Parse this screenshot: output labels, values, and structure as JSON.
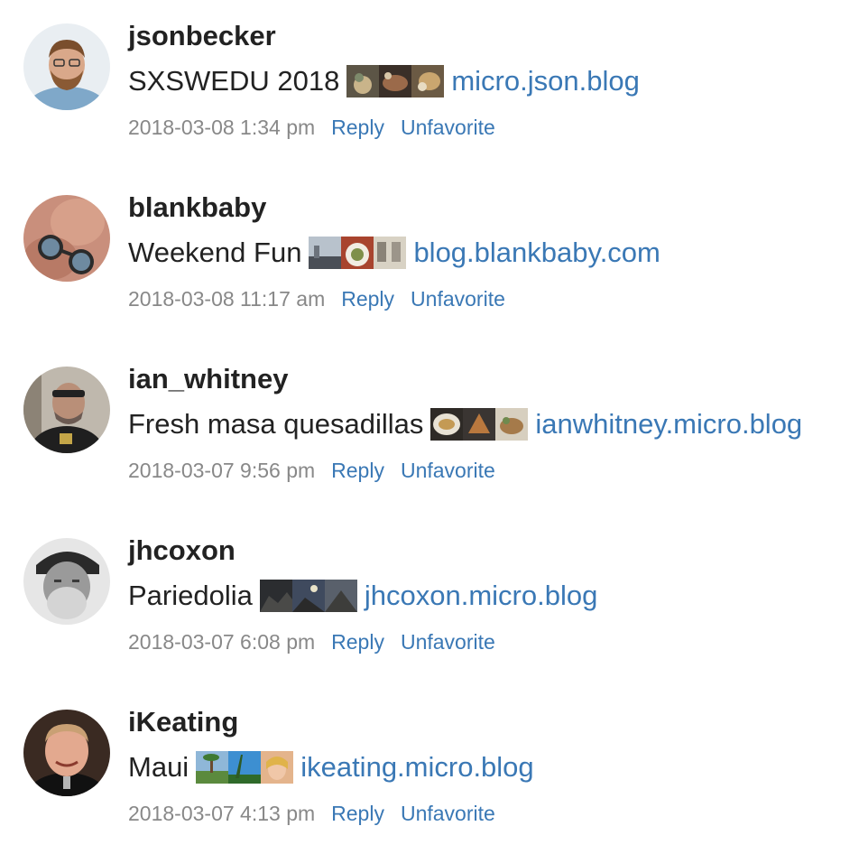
{
  "colors": {
    "text": "#222222",
    "link": "#3a78b5",
    "muted": "#888888",
    "background": "#ffffff"
  },
  "posts": [
    {
      "username": "jsonbecker",
      "text": "SXSWEDU 2018",
      "blog": "micro.json.blog",
      "timestamp": "2018-03-08 1:34 pm",
      "reply_label": "Reply",
      "unfavorite_label": "Unfavorite",
      "photo_count": 3
    },
    {
      "username": "blankbaby",
      "text": "Weekend Fun",
      "blog": "blog.blankbaby.com",
      "timestamp": "2018-03-08 11:17 am",
      "reply_label": "Reply",
      "unfavorite_label": "Unfavorite",
      "photo_count": 3
    },
    {
      "username": "ian_whitney",
      "text": "Fresh masa quesadillas",
      "blog": "ianwhitney.micro.blog",
      "timestamp": "2018-03-07 9:56 pm",
      "reply_label": "Reply",
      "unfavorite_label": "Unfavorite",
      "photo_count": 3
    },
    {
      "username": "jhcoxon",
      "text": "Pariedolia",
      "blog": "jhcoxon.micro.blog",
      "timestamp": "2018-03-07 6:08 pm",
      "reply_label": "Reply",
      "unfavorite_label": "Unfavorite",
      "photo_count": 3
    },
    {
      "username": "iKeating",
      "text": "Maui",
      "blog": "ikeating.micro.blog",
      "timestamp": "2018-03-07 4:13 pm",
      "reply_label": "Reply",
      "unfavorite_label": "Unfavorite",
      "photo_count": 3
    }
  ]
}
